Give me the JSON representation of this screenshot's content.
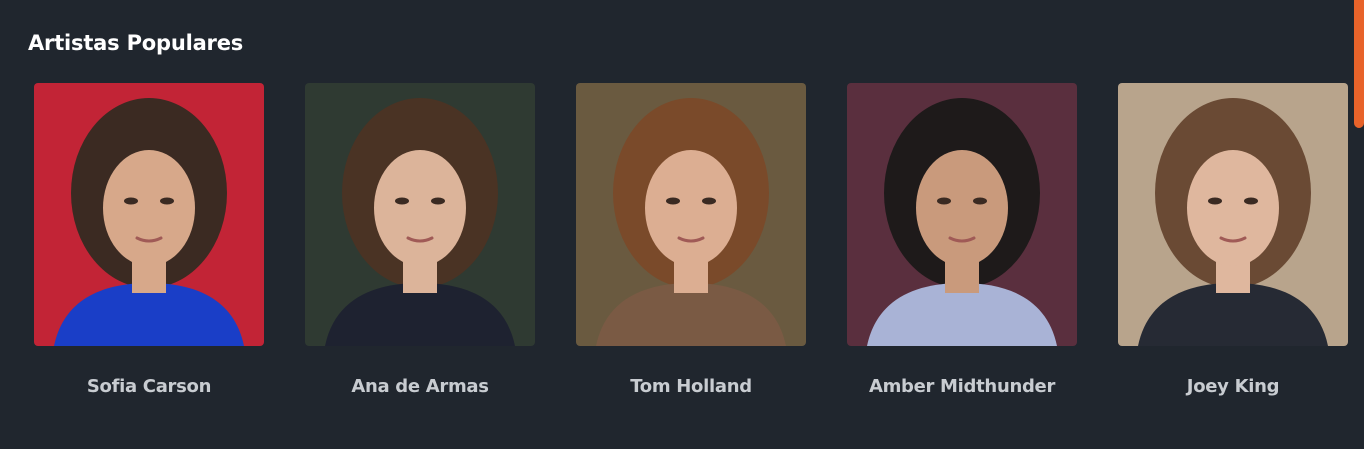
{
  "section": {
    "title": "Artistas Populares"
  },
  "artists": [
    {
      "name": "Sofia Carson",
      "image_icon": "portrait-photo",
      "background_color": "#c22436",
      "hair_color": "#3b2a22",
      "skin_color": "#d7a88a",
      "clothing_color": "#1a3ec7"
    },
    {
      "name": "Ana de Armas",
      "image_icon": "portrait-photo",
      "background_color": "#2f3a32",
      "hair_color": "#4a3324",
      "skin_color": "#dcb49a",
      "clothing_color": "#1e2230"
    },
    {
      "name": "Tom Holland",
      "image_icon": "portrait-photo",
      "background_color": "#6a5a40",
      "hair_color": "#7a4a2a",
      "skin_color": "#dcae92",
      "clothing_color": "#7a5a44"
    },
    {
      "name": "Amber Midthunder",
      "image_icon": "portrait-photo",
      "background_color": "#5a2f3e",
      "hair_color": "#1e1a1a",
      "skin_color": "#c99a7c",
      "clothing_color": "#a9b3d6"
    },
    {
      "name": "Joey King",
      "image_icon": "portrait-photo",
      "background_color": "#b8a48c",
      "hair_color": "#6a4a34",
      "skin_color": "#dfb79e",
      "clothing_color": "#262a34"
    }
  ],
  "colors": {
    "page_background": "#20262e",
    "title_text": "#ffffff",
    "name_text": "#c8ccd1",
    "scroll_thumb": "#e8632a"
  }
}
